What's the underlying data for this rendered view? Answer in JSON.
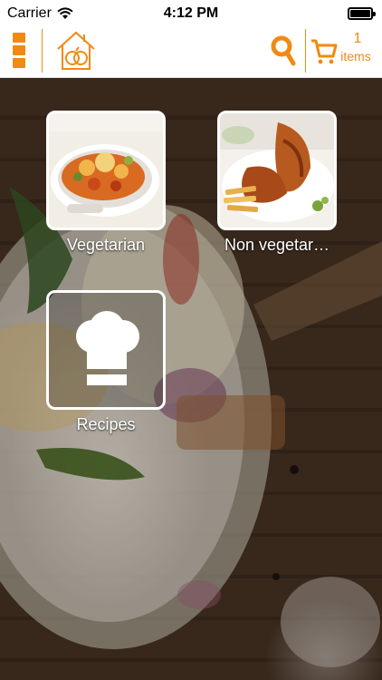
{
  "status_bar": {
    "carrier": "Carrier",
    "time": "4:12 PM"
  },
  "nav": {
    "menu_icon": "menu-icon",
    "home_icon": "home-icon",
    "search_icon": "search-icon",
    "cart_icon": "cart-icon",
    "cart_count": "1",
    "cart_items_label": "items",
    "accent_color": "#f08a12"
  },
  "categories": [
    {
      "label": "Vegetarian",
      "image": "vegetarian-dish-image"
    },
    {
      "label": "Non vegetar…",
      "image": "non-vegetarian-dish-image"
    },
    {
      "label": "Recipes",
      "image": "chef-hat-icon"
    }
  ]
}
